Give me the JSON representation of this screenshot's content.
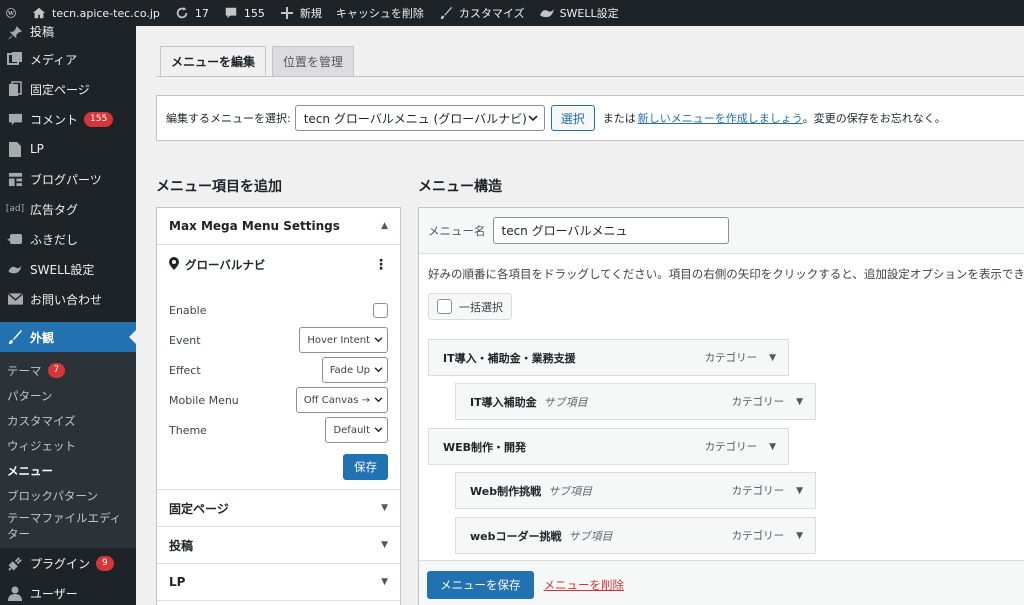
{
  "adminbar": {
    "site": "tecn.apice-tec.co.jp",
    "updates": "17",
    "comments": "155",
    "new_label": "新規",
    "cache_label": "キャッシュを削除",
    "customize_label": "カスタマイズ",
    "swell_label": "SWELL設定"
  },
  "sidebar": {
    "items": [
      {
        "label": "投稿",
        "icon": "pin-icon"
      },
      {
        "label": "メディア",
        "icon": "media-icon"
      },
      {
        "label": "固定ページ",
        "icon": "page-icon"
      },
      {
        "label": "コメント",
        "icon": "comment-icon",
        "badge": "155"
      },
      {
        "label": "LP",
        "icon": "document-icon"
      },
      {
        "label": "ブログパーツ",
        "icon": "grid-icon"
      },
      {
        "label": "広告タグ",
        "icon": "ad-icon"
      },
      {
        "label": "ふきだし",
        "icon": "balloon-icon"
      },
      {
        "label": "SWELL設定",
        "icon": "swell-icon"
      },
      {
        "label": "お問い合わせ",
        "icon": "mail-icon"
      },
      {
        "label": "外観",
        "icon": "brush-icon"
      }
    ],
    "submenu": [
      {
        "label": "テーマ",
        "badge": "7"
      },
      {
        "label": "パターン"
      },
      {
        "label": "カスタマイズ"
      },
      {
        "label": "ウィジェット"
      },
      {
        "label": "メニュー"
      },
      {
        "label": "ブロックパターン"
      },
      {
        "label": "テーマファイルエディター"
      }
    ],
    "after": [
      {
        "label": "プラグイン",
        "icon": "plugin-icon",
        "badge": "9"
      },
      {
        "label": "ユーザー",
        "icon": "user-icon"
      }
    ]
  },
  "tabs": {
    "edit": "メニューを編集",
    "locations": "位置を管理"
  },
  "manage": {
    "prefix": "編集するメニューを選択:",
    "selected_menu": "tecn グローバルメニュ (グローバルナビ)",
    "select_button": "選択",
    "or_text": "または",
    "create_link": "新しいメニューを作成しましょう",
    "suffix": "。変更の保存をお忘れなく。"
  },
  "add_items": {
    "title": "メニュー項目を追加",
    "mega_menu_title": "Max Mega Menu Settings",
    "location": "グローバルナビ",
    "options": [
      {
        "label": "Enable",
        "kind": "checkbox"
      },
      {
        "label": "Event",
        "value": "Hover Intent"
      },
      {
        "label": "Effect",
        "value": "Fade Up"
      },
      {
        "label": "Mobile Menu",
        "value": "Off Canvas →"
      },
      {
        "label": "Theme",
        "value": "Default"
      }
    ],
    "save_button": "保存",
    "sections": [
      "固定ページ",
      "投稿",
      "LP"
    ]
  },
  "structure": {
    "title": "メニュー構造",
    "name_label": "メニュー名",
    "menu_name": "tecn グローバルメニュ",
    "instructions": "好みの順番に各項目をドラッグしてください。項目の右側の矢印をクリックすると、追加設定オプションを表示できま",
    "bulk_select": "一括選択",
    "items": [
      {
        "title": "IT導入・補助金・業務支援",
        "sub": "",
        "type": "カテゴリー"
      },
      {
        "title": "IT導入補助金",
        "sub": "サブ項目",
        "type": "カテゴリー"
      },
      {
        "title": "WEB制作・開発",
        "sub": "",
        "type": "カテゴリー"
      },
      {
        "title": "Web制作挑戦",
        "sub": "サブ項目",
        "type": "カテゴリー"
      },
      {
        "title": "webコーダー挑戦",
        "sub": "サブ項目",
        "type": "カテゴリー"
      }
    ],
    "save_button": "メニューを保存",
    "delete_link": "メニューを削除"
  }
}
